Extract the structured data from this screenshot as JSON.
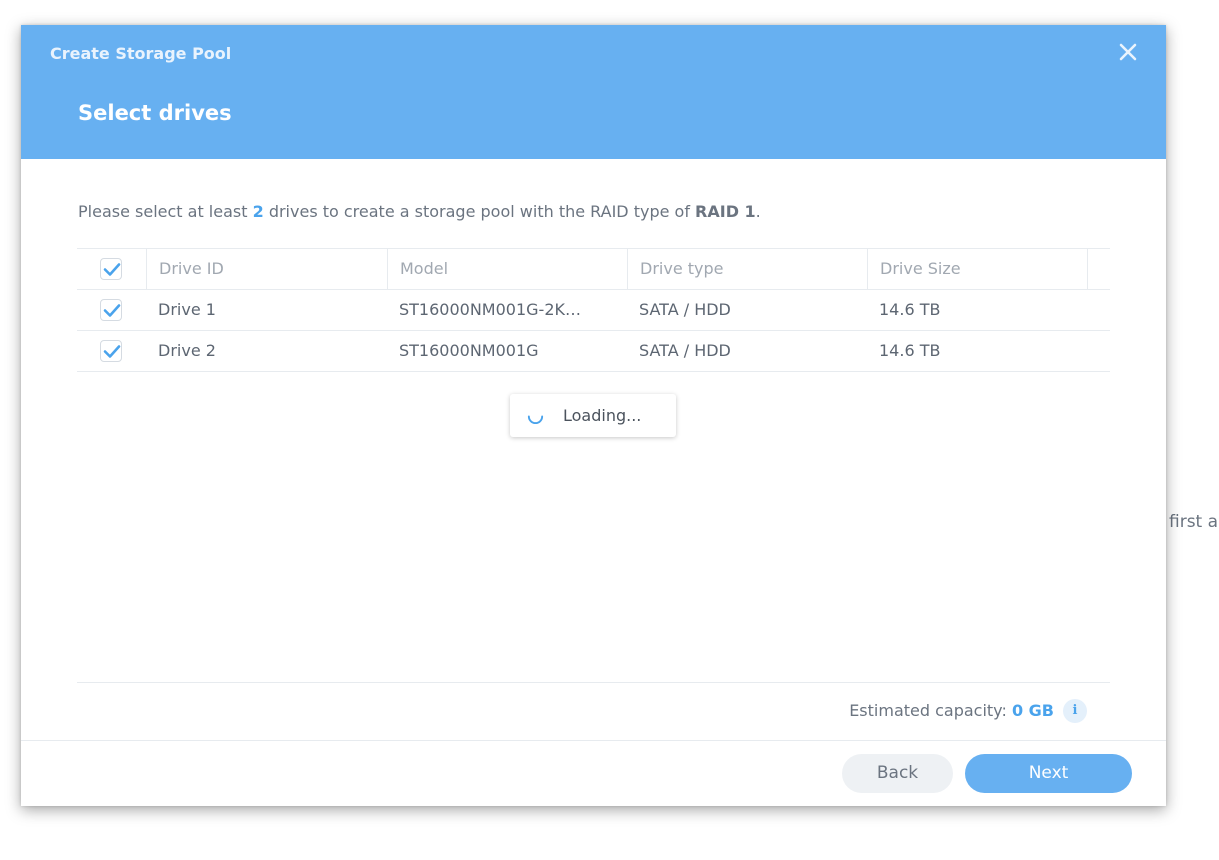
{
  "background": {
    "partial_text": "first a"
  },
  "dialog": {
    "title": "Create Storage Pool",
    "step_title": "Select drives",
    "intro": {
      "prefix": "Please select at least ",
      "count": "2",
      "middle": " drives to create a storage pool with the RAID type of ",
      "raid": "RAID 1",
      "suffix": "."
    },
    "table": {
      "columns": [
        "Drive ID",
        "Model",
        "Drive type",
        "Drive Size"
      ],
      "select_all_checked": true,
      "rows": [
        {
          "checked": true,
          "drive_id": "Drive 1",
          "model": "ST16000NM001G-2K…",
          "type": "SATA / HDD",
          "size": "14.6 TB"
        },
        {
          "checked": true,
          "drive_id": "Drive 2",
          "model": "ST16000NM001G",
          "type": "SATA / HDD",
          "size": "14.6 TB"
        }
      ]
    },
    "loading_text": "Loading...",
    "capacity": {
      "label": "Estimated capacity: ",
      "value": "0 GB"
    },
    "info_icon": "i",
    "buttons": {
      "back": "Back",
      "next": "Next"
    }
  },
  "colors": {
    "header_bg": "#67b0f1",
    "accent": "#4aa3ec",
    "text": "#6b7480"
  },
  "icons": {
    "close": "close-icon",
    "check": "check-icon",
    "spinner": "spinner-icon",
    "info": "info-icon"
  }
}
